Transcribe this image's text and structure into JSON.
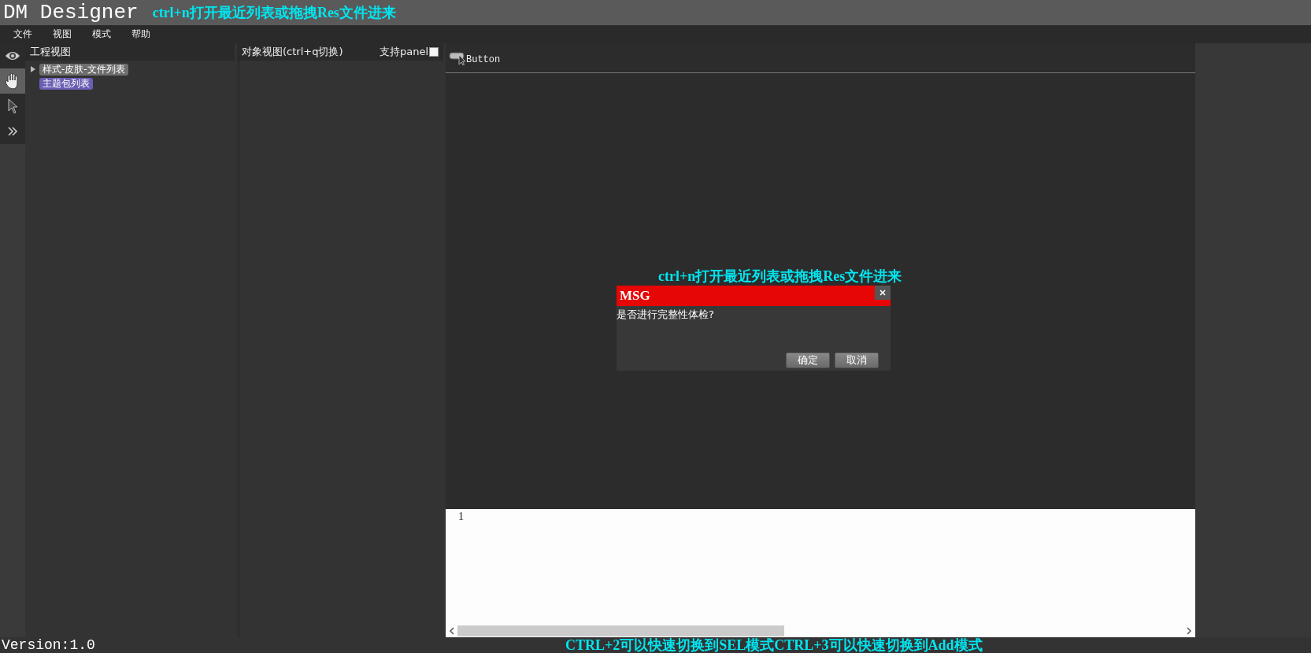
{
  "window": {
    "title": "DM Designer",
    "hint": "ctrl+n打开最近列表或拖拽Res文件进来"
  },
  "menu": [
    "文件",
    "视图",
    "模式",
    "帮助"
  ],
  "tools": [
    {
      "kind": "eye",
      "selected": false
    },
    {
      "kind": "hand",
      "selected": true
    },
    {
      "kind": "pointer",
      "selected": false
    },
    {
      "kind": "expand",
      "selected": false
    }
  ],
  "project_view": {
    "title": "工程视图",
    "items": [
      {
        "label": "样式-皮肤-文件列表",
        "kind": "group",
        "color": "#6e6e6e"
      },
      {
        "label": "主题包列表",
        "kind": "leaf",
        "color": "#6a5fb5"
      }
    ]
  },
  "object_view": {
    "title": "对象视图(ctrl+q切换)",
    "panel_toggle": {
      "label": "支持panel",
      "checked": false
    }
  },
  "canvas": {
    "palette": [
      {
        "label": "Button"
      }
    ],
    "hint": "ctrl+n打开最近列表或拖拽Res文件进来"
  },
  "editor": {
    "line_numbers": [
      "1"
    ]
  },
  "dialog": {
    "title": "MSG",
    "message": "是否进行完整性体检?",
    "buttons": [
      "确定",
      "取消"
    ]
  },
  "footer": {
    "version": "Version:1.0",
    "hint": "CTRL+2可以快速切换到SEL模式CTRL+3可以快速切换到Add模式"
  }
}
